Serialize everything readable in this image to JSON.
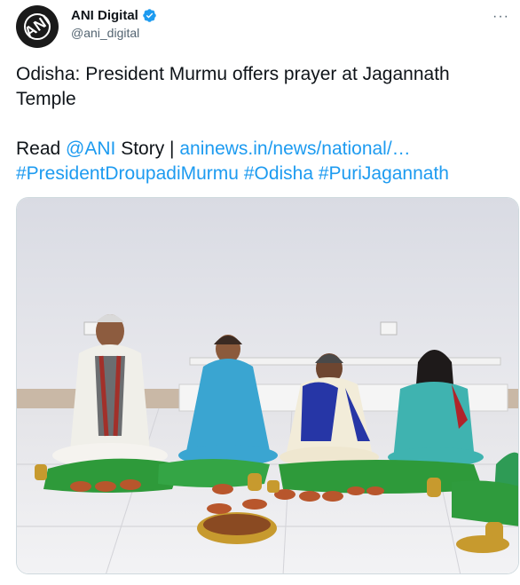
{
  "tweet": {
    "author": {
      "display_name": "ANI Digital",
      "handle": "@ani_digital",
      "avatar_text": "ANI",
      "verified": true
    },
    "more_icon": "more-dots-icon",
    "text": {
      "line1": "Odisha: President Murmu offers prayer at Jagannath",
      "line2": "Temple",
      "read_prefix": "Read ",
      "mention": "@ANI",
      "story_text": " Story | ",
      "url": "aninews.in/news/national/…",
      "hashtag1": "#PresidentDroupadiMurmu",
      "hashtag2": "#Odisha",
      "hashtag3": "#PuriJagannath"
    },
    "media": {
      "type": "photo"
    }
  },
  "colors": {
    "link": "#1d9bf0",
    "text": "#0f1419",
    "secondary": "#536471",
    "verified": "#1d9bf0"
  }
}
